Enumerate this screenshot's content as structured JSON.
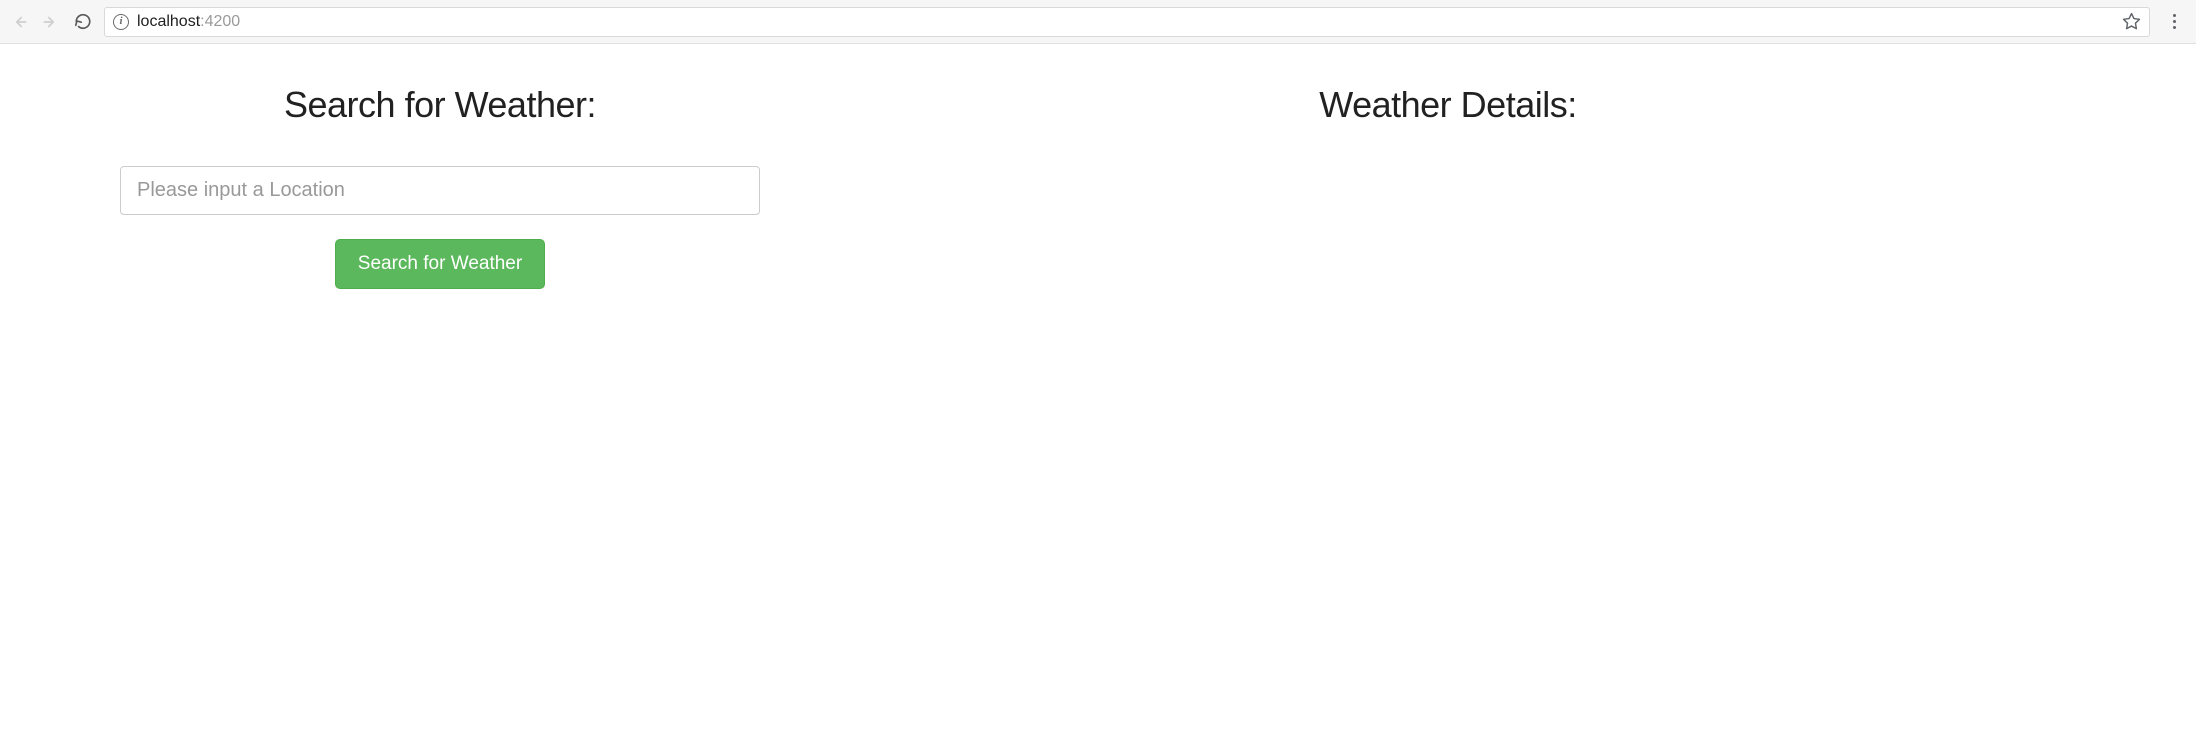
{
  "browser": {
    "url_host": "localhost",
    "url_port": ":4200"
  },
  "page": {
    "search_heading": "Search for Weather:",
    "details_heading": "Weather Details:",
    "location_placeholder": "Please input a Location",
    "location_value": "",
    "search_button_label": "Search for Weather"
  }
}
